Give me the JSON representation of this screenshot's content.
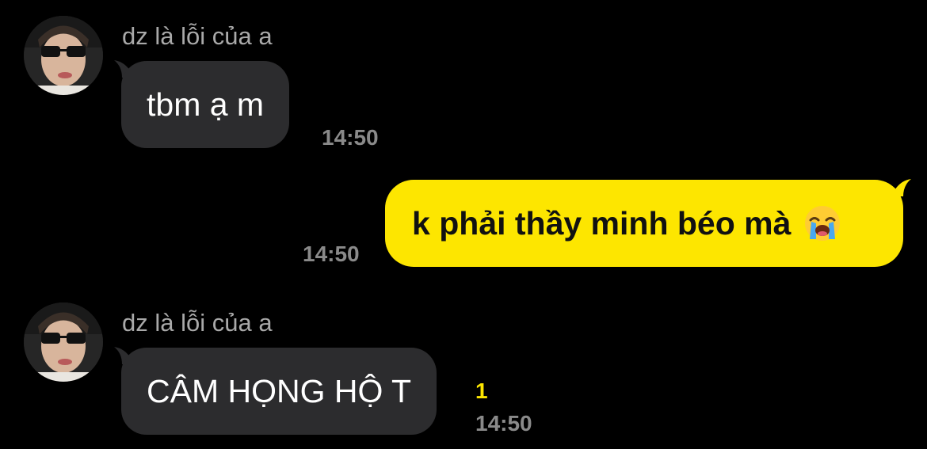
{
  "messages": [
    {
      "sender_name": "dz là lỗi của a",
      "text": "tbm ạ m",
      "time": "14:50"
    },
    {
      "text": "k phải thầy minh béo mà",
      "emoji": "loudly-crying-face-icon",
      "time": "14:50"
    },
    {
      "sender_name": "dz là lỗi của a",
      "text": "CÂM HỌNG HỘ T",
      "unread_count": "1",
      "time": "14:50"
    }
  ],
  "colors": {
    "background": "#000000",
    "incoming_bubble": "#2c2c2e",
    "outgoing_bubble": "#fde600",
    "timestamp": "#8a8a8a",
    "unread": "#fde600"
  }
}
